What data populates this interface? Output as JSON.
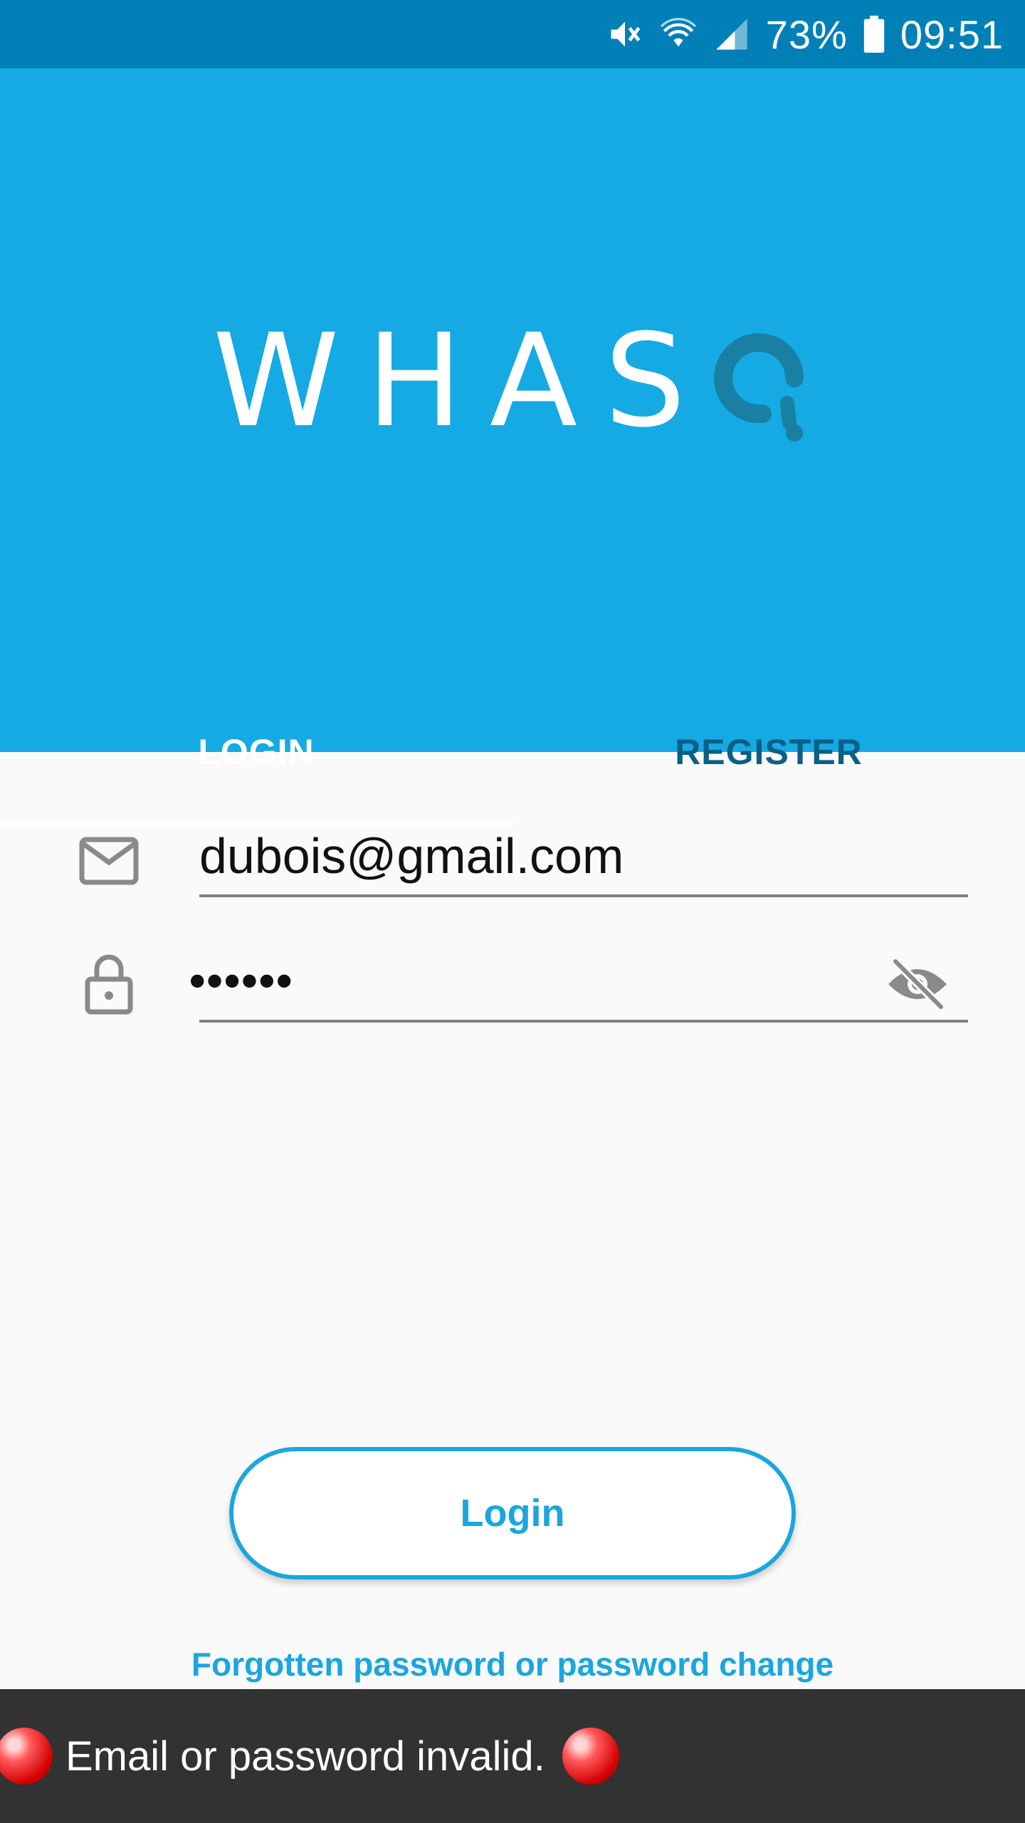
{
  "status_bar": {
    "battery_percent": "73%",
    "time": "09:51",
    "icons": [
      "mute-icon",
      "wifi-icon",
      "signal-icon",
      "battery-icon"
    ]
  },
  "header": {
    "logo_text": "WHAS",
    "logo_last_letter_icon": "q-logo-icon",
    "colors": {
      "header_bg": "#15aae3",
      "status_bg": "#0080b7",
      "logo_accent": "#1a80a3"
    }
  },
  "tabs": [
    {
      "label": "LOGIN",
      "active": true
    },
    {
      "label": "REGISTER",
      "active": false
    }
  ],
  "form": {
    "email_value": "dubois@gmail.com",
    "email_icon": "mail-icon",
    "password_value": "••••••",
    "password_icon": "lock-icon",
    "visibility_icon": "eye-off-icon"
  },
  "actions": {
    "login_label": "Login",
    "forgot_label": "Forgotten password or password change"
  },
  "toast": {
    "message": "Email or password invalid."
  }
}
